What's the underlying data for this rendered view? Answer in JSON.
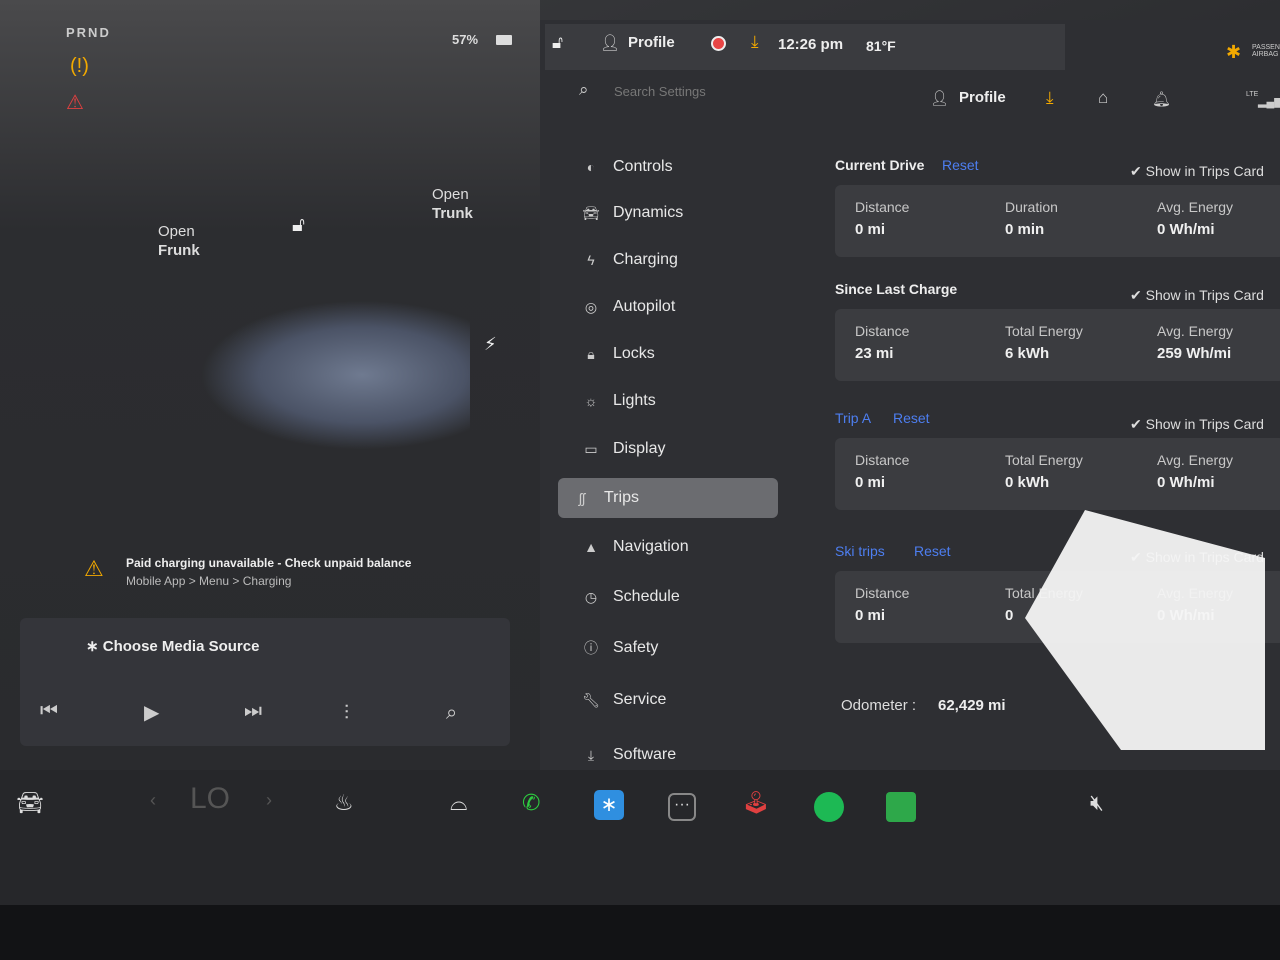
{
  "status_left": {
    "gear": "PRND",
    "battery": "57%"
  },
  "car": {
    "open_frunk": "Open\nFrunk",
    "open_frunk_l1": "Open",
    "open_frunk_l2": "Frunk",
    "open_trunk_l1": "Open",
    "open_trunk_l2": "Trunk"
  },
  "alert": {
    "title": "Paid charging unavailable - Check unpaid balance",
    "subtitle": "Mobile App > Menu > Charging"
  },
  "media": {
    "source": "Choose Media Source"
  },
  "top_bar": {
    "profile": "Profile",
    "time": "12:26 pm",
    "temperature": "81°F",
    "airbag": "PASSENGER AIRBAG"
  },
  "settings_header": {
    "search_placeholder": "Search Settings",
    "profile": "Profile",
    "signal": "LTE"
  },
  "menu": [
    {
      "label": "Controls",
      "icon": "toggle-icon"
    },
    {
      "label": "Dynamics",
      "icon": "car-icon"
    },
    {
      "label": "Charging",
      "icon": "bolt-icon"
    },
    {
      "label": "Autopilot",
      "icon": "steering-wheel-icon"
    },
    {
      "label": "Locks",
      "icon": "lock-icon"
    },
    {
      "label": "Lights",
      "icon": "sun-icon"
    },
    {
      "label": "Display",
      "icon": "display-icon"
    },
    {
      "label": "Trips",
      "icon": "trips-icon",
      "selected": true
    },
    {
      "label": "Navigation",
      "icon": "navigation-icon"
    },
    {
      "label": "Schedule",
      "icon": "clock-icon"
    },
    {
      "label": "Safety",
      "icon": "alert-circle-icon"
    },
    {
      "label": "Service",
      "icon": "wrench-icon"
    },
    {
      "label": "Software",
      "icon": "download-icon"
    }
  ],
  "trips": {
    "current_drive": {
      "title": "Current Drive",
      "reset": "Reset",
      "show": "Show in Trips Card",
      "labels": [
        "Distance",
        "Duration",
        "Avg. Energy"
      ],
      "values": [
        "0 mi",
        "0 min",
        "0 Wh/mi"
      ]
    },
    "since_last_charge": {
      "title": "Since Last Charge",
      "show": "Show in Trips Card",
      "labels": [
        "Distance",
        "Total Energy",
        "Avg. Energy"
      ],
      "values": [
        "23 mi",
        "6 kWh",
        "259 Wh/mi"
      ]
    },
    "trip_a": {
      "title": "Trip A",
      "reset": "Reset",
      "show": "Show in Trips Card",
      "labels": [
        "Distance",
        "Total Energy",
        "Avg. Energy"
      ],
      "values": [
        "0 mi",
        "0 kWh",
        "0 Wh/mi"
      ]
    },
    "ski_trips": {
      "title": "Ski trips",
      "reset": "Reset",
      "show": "Show in Trips Card",
      "labels": [
        "Distance",
        "Total Energy",
        "Avg. Energy"
      ],
      "values": [
        "0 mi",
        "0",
        "0 Wh/mi"
      ]
    },
    "odometer_label": "Odometer :",
    "odometer_value": "62,429 mi"
  },
  "dock": {
    "climate_temp": "LO"
  },
  "colors": {
    "accent": "#4d7ef0",
    "warning": "#f2a900",
    "phone": "#2ecc40",
    "spotify": "#1db954"
  }
}
